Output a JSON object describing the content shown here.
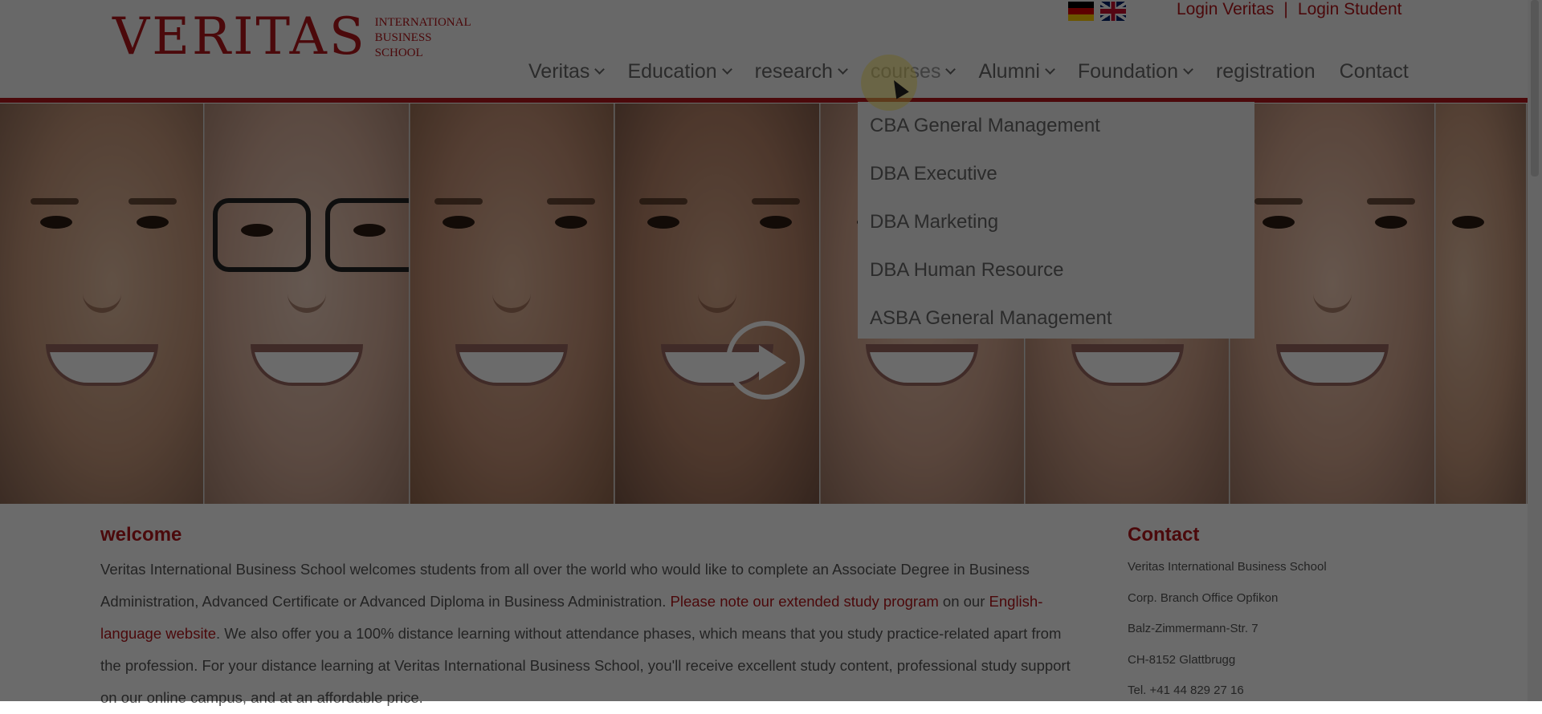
{
  "brand": {
    "name": "VERITAS",
    "subtitle_lines": [
      "INTERNATIONAL",
      "BUSINESS",
      "SCHOOL"
    ],
    "accent_color": "#b3161b"
  },
  "header": {
    "flags": [
      {
        "name": "german-flag-icon"
      },
      {
        "name": "english-flag-icon"
      }
    ],
    "login_links": [
      "Login Veritas",
      "Login Student"
    ],
    "separator": "|"
  },
  "nav": {
    "items": [
      {
        "label": "Veritas",
        "has_dropdown": true
      },
      {
        "label": "Education",
        "has_dropdown": true
      },
      {
        "label": "research",
        "has_dropdown": true
      },
      {
        "label": "courses",
        "has_dropdown": true,
        "active": true
      },
      {
        "label": "Alumni",
        "has_dropdown": true
      },
      {
        "label": "Foundation",
        "has_dropdown": true
      },
      {
        "label": "registration",
        "has_dropdown": false
      },
      {
        "label": "Contact",
        "has_dropdown": false
      }
    ]
  },
  "dropdown": {
    "items": [
      "CBA General Management",
      "DBA Executive",
      "DBA Marketing",
      "DBA Human Resource",
      "ASBA General Management"
    ]
  },
  "hero": {
    "play_icon": "play-icon"
  },
  "welcome": {
    "title": "welcome",
    "text_1": "Veritas International Business School welcomes students from all over the world who would like to complete an Associate Degree in Business Administration, Advanced Certificate or Advanced Diploma in Business Administration. ",
    "link_1": "Please note our extended study program",
    "text_2": " on our ",
    "link_2": "English-language website",
    "text_3": ". We also offer you a 100% distance learning without attendance phases, which means that you study practice-related apart from the profession. For your distance learning at Veritas International Business School, you'll receive excellent study content, professional study support on our online campus, and at an affordable price."
  },
  "contact": {
    "title": "Contact",
    "lines": [
      "Veritas International Business School",
      "Corp. Branch Office Opfikon",
      "Balz-Zimmermann-Str. 7",
      "CH-8152 Glattbrugg",
      "Tel.  +41 44 829 27 16"
    ]
  }
}
